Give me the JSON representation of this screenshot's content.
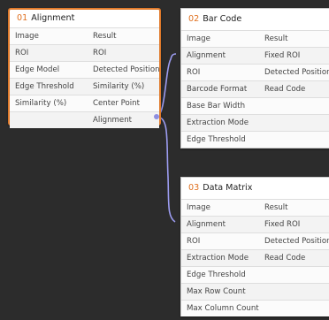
{
  "nodes": {
    "alignment": {
      "number": "01",
      "title": "Alignment",
      "rows": [
        {
          "left": "Image",
          "right": "Result"
        },
        {
          "left": "ROI",
          "right": "ROI"
        },
        {
          "left": "Edge Model",
          "right": "Detected Position"
        },
        {
          "left": "Edge Threshold",
          "right": "Similarity (%)"
        },
        {
          "left": "Similarity (%)",
          "right": "Center Point"
        },
        {
          "left": "",
          "right": "Alignment"
        }
      ]
    },
    "barcode": {
      "number": "02",
      "title": "Bar Code",
      "rows": [
        {
          "left": "Image",
          "right": "Result"
        },
        {
          "left": "Alignment",
          "right": "Fixed ROI"
        },
        {
          "left": "ROI",
          "right": "Detected Position"
        },
        {
          "left": "Barcode Format",
          "right": "Read Code"
        },
        {
          "left": "Base Bar Width",
          "right": ""
        },
        {
          "left": "Extraction Mode",
          "right": ""
        },
        {
          "left": "Edge Threshold",
          "right": ""
        }
      ]
    },
    "datamatrix": {
      "number": "03",
      "title": "Data Matrix",
      "rows": [
        {
          "left": "Image",
          "right": "Result"
        },
        {
          "left": "Alignment",
          "right": "Fixed ROI"
        },
        {
          "left": "ROI",
          "right": "Detected Position"
        },
        {
          "left": "Extraction Mode",
          "right": "Read Code"
        },
        {
          "left": "Edge Threshold",
          "right": ""
        },
        {
          "left": "Max Row Count",
          "right": ""
        },
        {
          "left": "Max Column Count",
          "right": ""
        }
      ]
    }
  },
  "colors": {
    "canvas": "#2c2c2c",
    "selection": "#e07a2b",
    "wire": "#9c9cf0",
    "node_number": "#e0701f"
  }
}
